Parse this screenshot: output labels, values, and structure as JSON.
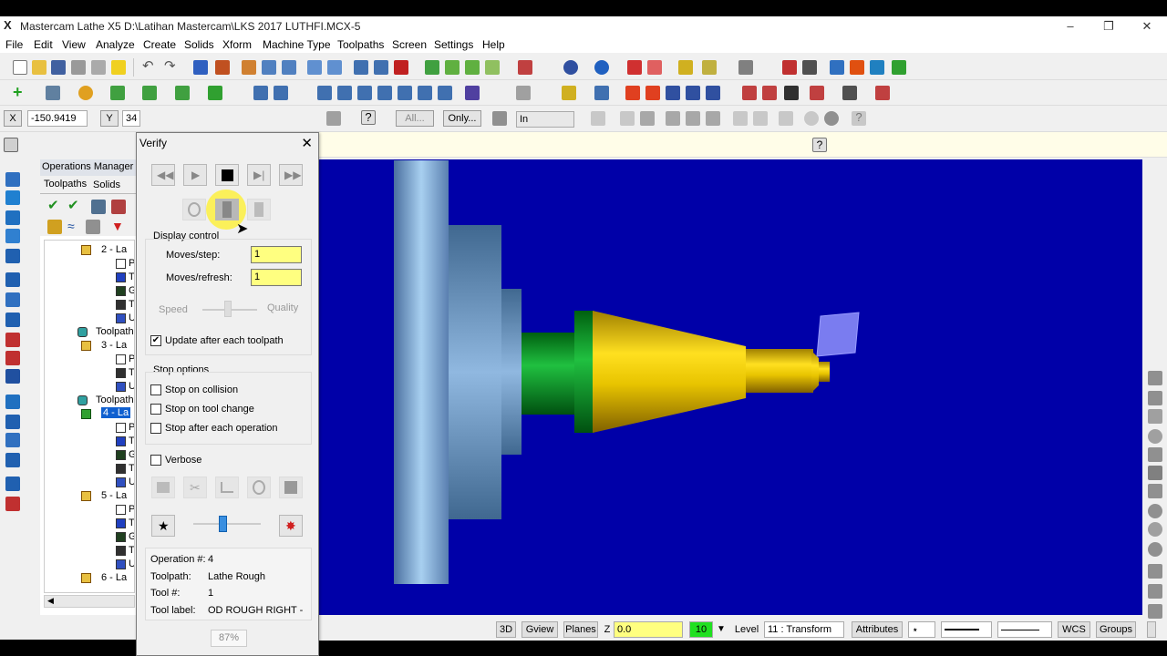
{
  "window": {
    "title": "Mastercam Lathe X5  D:\\Latihan Mastercam\\LKS 2017 LUTHFI.MCX-5",
    "logo": "X"
  },
  "menu": [
    "File",
    "Edit",
    "View",
    "Analyze",
    "Create",
    "Solids",
    "Xform",
    "Machine Type",
    "Toolpaths",
    "Screen",
    "Settings",
    "Help"
  ],
  "coords": {
    "x_label": "X",
    "x_value": "-150.9419",
    "y_label": "Y",
    "y_value": "34"
  },
  "toolbar3": {
    "all_btn": "All...",
    "only_btn": "Only...",
    "in_select": "In"
  },
  "ops_manager": {
    "title": "Operations Manager",
    "tabs": [
      "Toolpaths",
      "Solids"
    ],
    "tree": [
      "2 - La",
      "P",
      "T",
      "G",
      "T",
      "U",
      "Toolpath",
      "3 - La",
      "P",
      "T",
      "U",
      "Toolpath",
      "4 - La",
      "P",
      "T",
      "G",
      "T",
      "U",
      "5 - La",
      "P",
      "T",
      "G",
      "T",
      "U",
      "6 - La"
    ]
  },
  "verify": {
    "title": "Verify",
    "display_control": "Display control",
    "moves_step_label": "Moves/step:",
    "moves_step_value": "1",
    "moves_refresh_label": "Moves/refresh:",
    "moves_refresh_value": "1",
    "speed_label": "Speed",
    "quality_label": "Quality",
    "update_label": "Update after each toolpath",
    "update_checked": true,
    "stop_options": "Stop options",
    "stop_collision": "Stop on collision",
    "stop_tool_change": "Stop on tool change",
    "stop_each_op": "Stop after each operation",
    "verbose": "Verbose",
    "op_label": "Operation #:",
    "op_value": "4",
    "toolpath_label": "Toolpath:",
    "toolpath_value": "Lathe Rough",
    "tool_label": "Tool #:",
    "tool_value": "1",
    "toollabel_label": "Tool label:",
    "toollabel_value": "OD ROUGH RIGHT -",
    "progress": "87%"
  },
  "statusbar": {
    "view3d": "3D",
    "gview": "Gview",
    "planes": "Planes",
    "z_label": "Z",
    "z_value": "0.0",
    "color_value": "10",
    "level_label": "Level",
    "level_value": "11 : Transform",
    "attributes": "Attributes",
    "wcs": "WCS",
    "groups": "Groups"
  },
  "colors": {
    "viewport": "#0000a8",
    "yellow_part": "#e8c400",
    "green_part": "#10a030",
    "chuck": "#6a8fc0",
    "tool_insert": "#7a7cf0"
  }
}
